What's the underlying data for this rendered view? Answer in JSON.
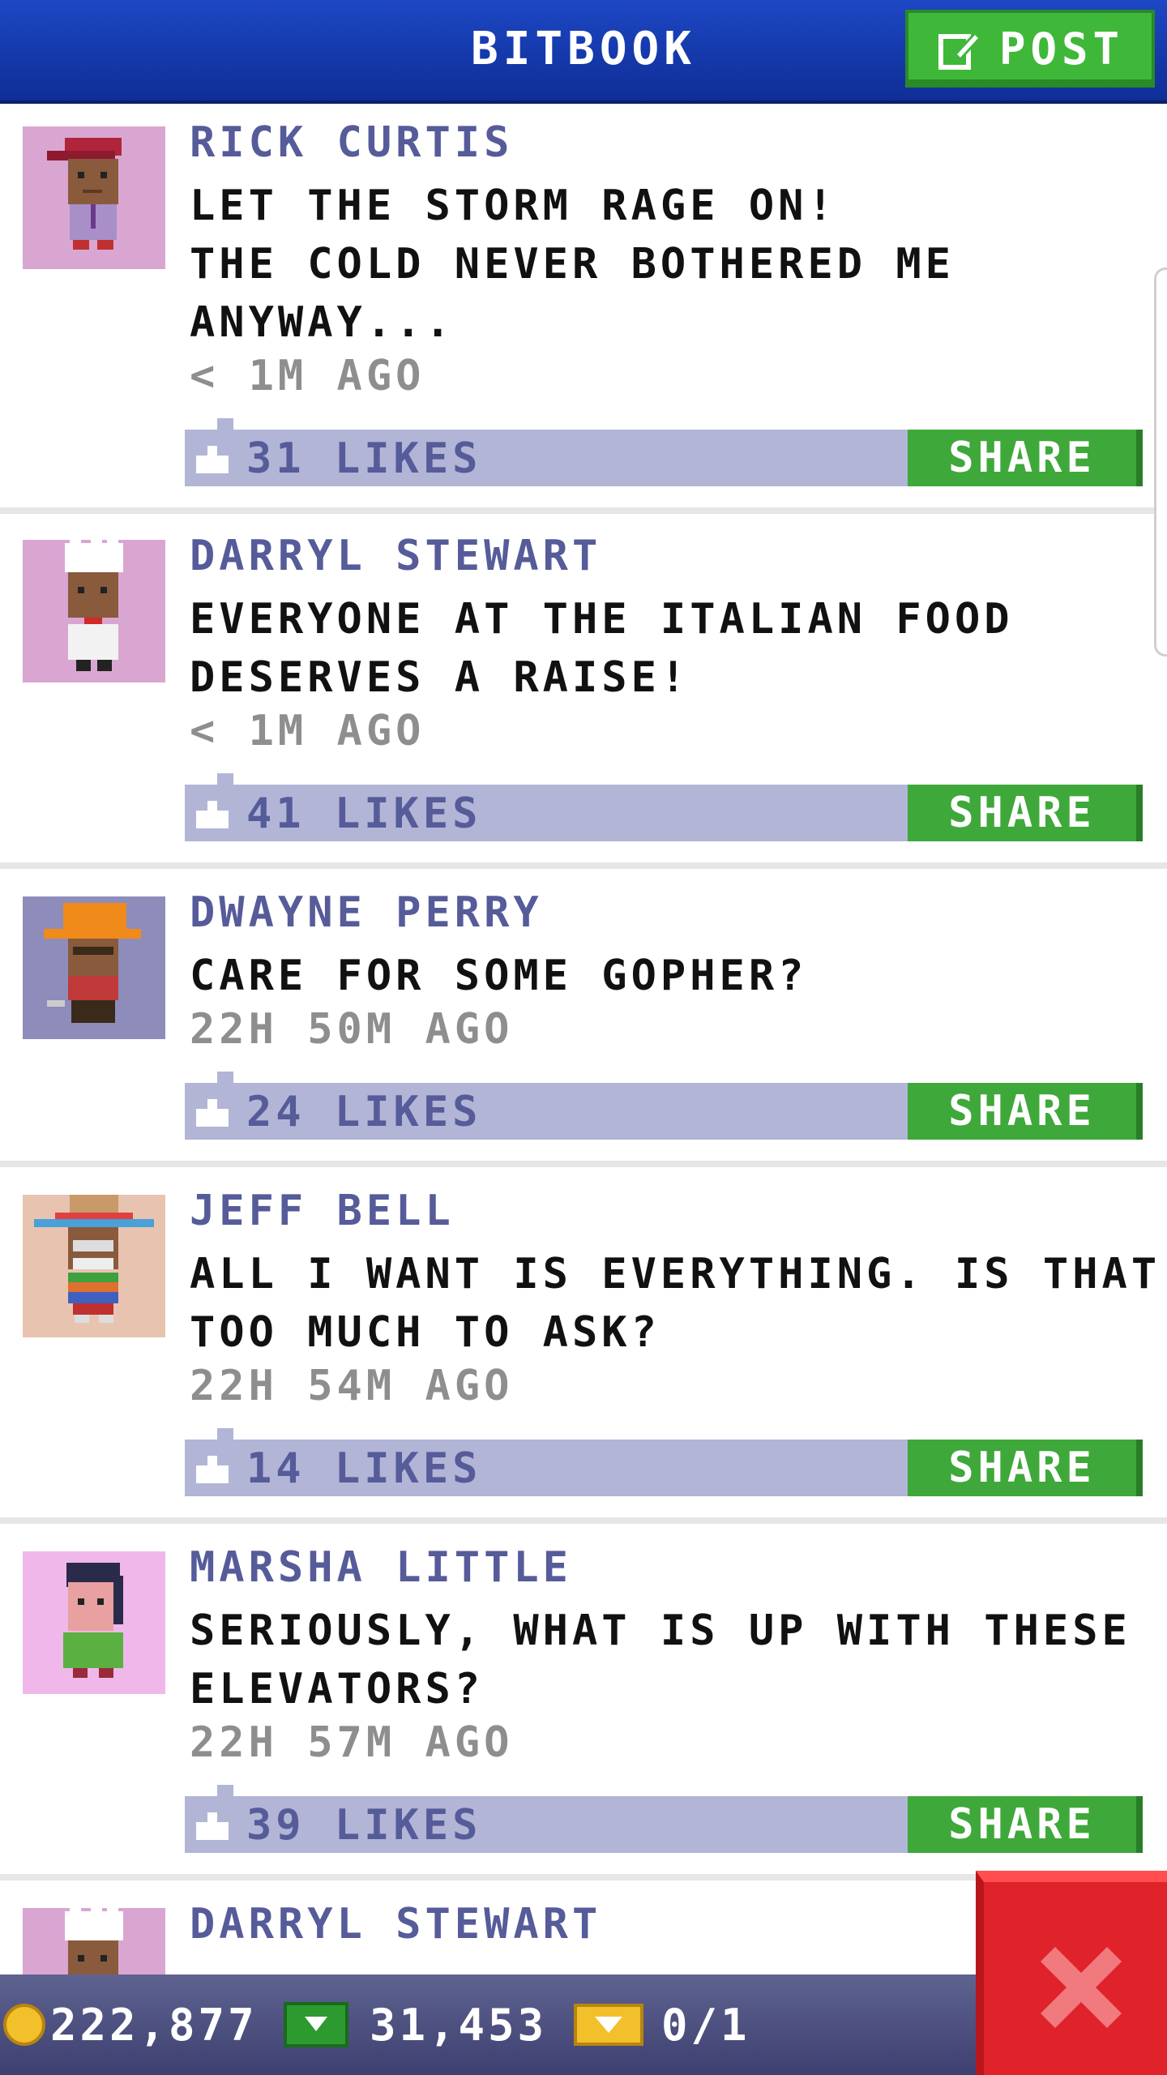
{
  "header": {
    "title": "BITBOOK",
    "post_label": "POST"
  },
  "posts": [
    {
      "name": "RICK CURTIS",
      "lines": [
        "LET THE STORM RAGE ON!",
        "THE COLD NEVER BOTHERED ME",
        "ANYWAY..."
      ],
      "time": "< 1M AGO",
      "likes": "31 LIKES",
      "share": "SHARE",
      "avatar_bg": "#d9a6d2",
      "avatar_icon": "person-red-cap-icon"
    },
    {
      "name": "DARRYL STEWART",
      "lines": [
        "EVERYONE AT THE ITALIAN FOOD",
        "DESERVES A RAISE!"
      ],
      "time": "< 1M AGO",
      "likes": "41 LIKES",
      "share": "SHARE",
      "avatar_bg": "#d9a6d2",
      "avatar_icon": "chef-icon"
    },
    {
      "name": "DWAYNE PERRY",
      "lines": [
        "CARE FOR SOME GOPHER?"
      ],
      "time": "22H 50M AGO",
      "likes": "24 LIKES",
      "share": "SHARE",
      "avatar_bg": "#8e8cba",
      "avatar_icon": "construction-worker-icon"
    },
    {
      "name": "JEFF BELL",
      "lines": [
        "ALL I WANT IS EVERYTHING. IS THAT",
        "TOO MUCH TO ASK?"
      ],
      "time": "22H 54M AGO",
      "likes": "14 LIKES",
      "share": "SHARE",
      "avatar_bg": "#e8c4b0",
      "avatar_icon": "sombrero-man-icon"
    },
    {
      "name": "MARSHA LITTLE",
      "lines": [
        "SERIOUSLY, WHAT IS UP WITH THESE",
        "ELEVATORS?"
      ],
      "time": "22H 57M AGO",
      "likes": "39 LIKES",
      "share": "SHARE",
      "avatar_bg": "#f0b8ea",
      "avatar_icon": "woman-green-shirt-icon"
    },
    {
      "name": "DARRYL STEWART",
      "lines": [],
      "avatar_bg": "#d9a6d2",
      "avatar_icon": "chef-icon"
    }
  ],
  "footer": {
    "coins": "222,877",
    "bux": "31,453",
    "tickets": "0/1"
  },
  "colors": {
    "header_blue": "#1d47c4",
    "name_purple": "#565b99",
    "likes_bar": "#b2b5d6",
    "share_green": "#3fa83a",
    "close_red": "#e0232b"
  }
}
